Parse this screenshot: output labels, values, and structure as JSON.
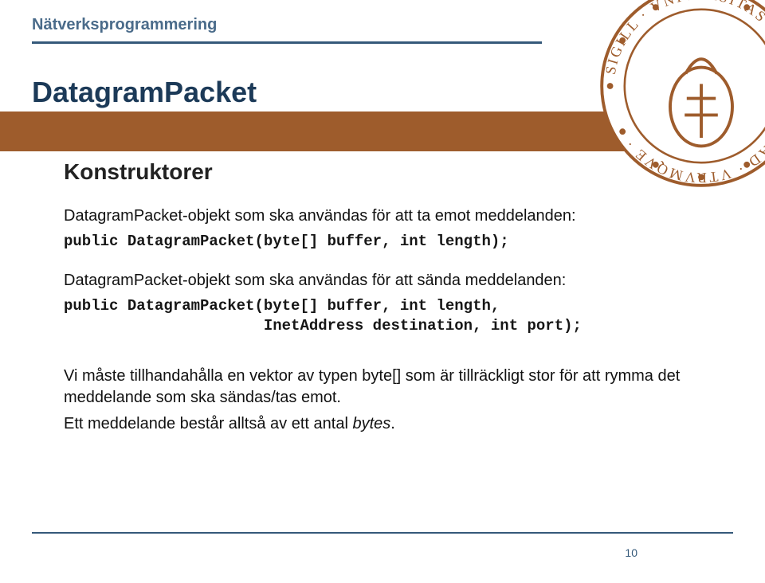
{
  "header": {
    "breadcrumb": "Nätverksprogrammering",
    "title": "DatagramPacket"
  },
  "body": {
    "subhead": "Konstruktorer",
    "para1": "DatagramPacket-objekt som ska användas för att ta emot meddelanden:",
    "code1": "public DatagramPacket(byte[] buffer, int length);",
    "para2": "DatagramPacket-objekt som ska användas för att sända meddelanden:",
    "code2_l1": "public DatagramPacket(byte[] buffer, int length,",
    "code2_l2": "                      InetAddress destination, int port);",
    "para3a": "Vi måste tillhandahålla en vektor av typen byte[] som är tillräckligt stor för att rymma det meddelande som ska sändas/tas emot.",
    "para3b_pre": "Ett meddelande består alltså av ett antal ",
    "para3b_em": "bytes",
    "para3b_post": "."
  },
  "footer": {
    "page": "10"
  }
}
